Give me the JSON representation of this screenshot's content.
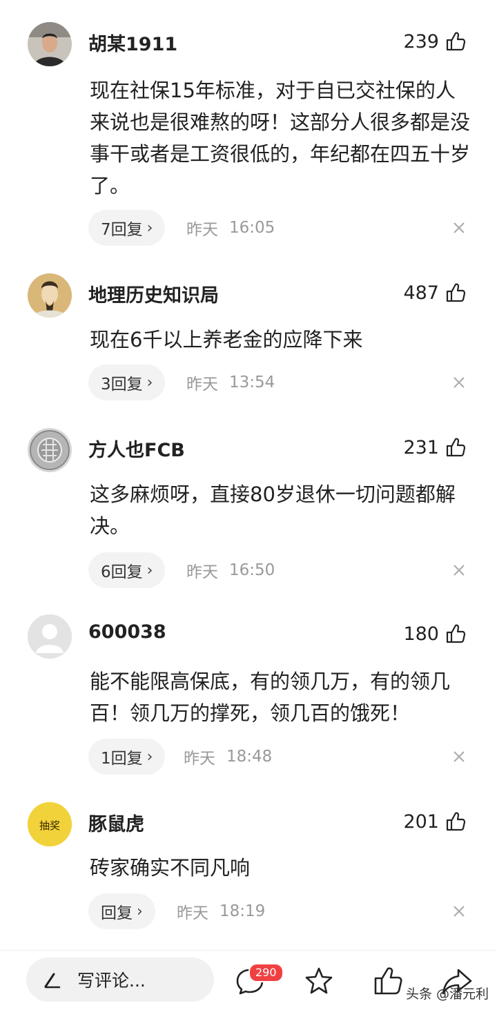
{
  "comments": [
    {
      "username": "胡某1911",
      "likes": "239",
      "text": "现在社保15年标准，对于自已交社保的人来说也是很难熬的呀！这部分人很多都是没事干或者是工资很低的，年纪都在四五十岁了。",
      "replies": "7回复",
      "day": "昨天",
      "time": "16:05",
      "avatar": "man-photo-avatar"
    },
    {
      "username": "地理历史知识局",
      "likes": "487",
      "text": "现在6千以上养老金的应降下来",
      "replies": "3回复",
      "day": "昨天",
      "time": "13:54",
      "avatar": "ancient-portrait-avatar"
    },
    {
      "username": "方人也FCB",
      "likes": "231",
      "text": "这多麻烦呀，直接80岁退休一切问题都解决。",
      "replies": "6回复",
      "day": "昨天",
      "time": "16:50",
      "avatar": "fc-bayern-logo-avatar"
    },
    {
      "username": "600038",
      "likes": "180",
      "text": "能不能限高保底，有的领几万，有的领几百！领几万的撑死，领几百的饿死！",
      "replies": "1回复",
      "day": "昨天",
      "time": "18:48",
      "avatar": "default-person-avatar"
    },
    {
      "username": "豚鼠虎",
      "likes": "201",
      "text": "砖家确实不同凡响",
      "replies": "回复",
      "day": "昨天",
      "time": "18:19",
      "avatar": "lottery-badge-avatar",
      "avatar_text": "抽奖"
    }
  ],
  "bottom_bar": {
    "write_placeholder": "写评论...",
    "comment_count": "290",
    "watermark": "头条 @潘元利"
  },
  "colors": {
    "badge": "#f04142",
    "secondary_text": "#999999",
    "pill_bg": "#f3f3f3"
  }
}
